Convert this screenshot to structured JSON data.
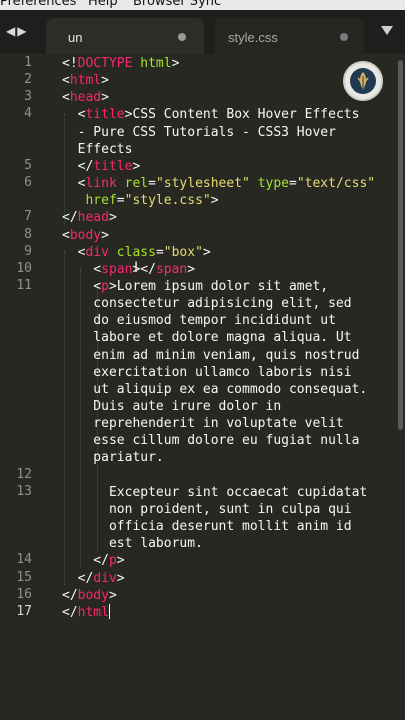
{
  "menubar": {
    "items": [
      "Preferences",
      "Help",
      "Browser Sync"
    ]
  },
  "tabs": [
    {
      "label": "un",
      "active": true
    },
    {
      "label": "style.css",
      "active": false
    }
  ],
  "icons": {
    "nav": "left-right-arrows",
    "dropdown": "triangle-down",
    "logo": "leaf-emblem"
  },
  "colors": {
    "background": "#272822",
    "tag": "#f92672",
    "attribute": "#a6e22e",
    "string": "#e6db74",
    "text": "#f8f8f2"
  },
  "editor": {
    "line_numbers": [
      "1",
      "2",
      "3",
      "4",
      "5",
      "6",
      "7",
      "8",
      "9",
      "10",
      "11",
      "12",
      "13",
      "14",
      "15",
      "16",
      "17"
    ],
    "current_line": "17",
    "code": [
      [
        [
          "p",
          "<!"
        ],
        [
          "t",
          "DOCTYPE"
        ],
        [
          "p",
          " "
        ],
        [
          "a",
          "html"
        ],
        [
          "p",
          ">"
        ]
      ],
      [
        [
          "p",
          "<"
        ],
        [
          "t",
          "html"
        ],
        [
          "p",
          ">"
        ]
      ],
      [
        [
          "p",
          "<"
        ],
        [
          "t",
          "head"
        ],
        [
          "p",
          ">"
        ]
      ],
      [
        [
          "p",
          "  <"
        ],
        [
          "t",
          "title"
        ],
        [
          "p",
          ">"
        ],
        [
          "x",
          "CSS Content Box Hover Effects"
        ]
      ],
      [
        [
          "x",
          "  - Pure CSS Tutorials - CSS3 Hover"
        ]
      ],
      [
        [
          "x",
          "  Effects"
        ]
      ],
      [
        [
          "p",
          "  </"
        ],
        [
          "t",
          "title"
        ],
        [
          "p",
          ">"
        ]
      ],
      [
        [
          "p",
          "  <"
        ],
        [
          "t",
          "link"
        ],
        [
          "p",
          " "
        ],
        [
          "a",
          "rel"
        ],
        [
          "p",
          "="
        ],
        [
          "s",
          "\"stylesheet\""
        ],
        [
          "p",
          " "
        ],
        [
          "a",
          "type"
        ],
        [
          "p",
          "="
        ],
        [
          "s",
          "\"text/css\""
        ]
      ],
      [
        [
          "p",
          "   "
        ],
        [
          "a",
          "href"
        ],
        [
          "p",
          "="
        ],
        [
          "s",
          "\"style.css\""
        ],
        [
          "p",
          ">"
        ]
      ],
      [
        [
          "p",
          "</"
        ],
        [
          "t",
          "head"
        ],
        [
          "p",
          ">"
        ]
      ],
      [
        [
          "p",
          "<"
        ],
        [
          "t",
          "body"
        ],
        [
          "p",
          ">"
        ]
      ],
      [
        [
          "p",
          "  <"
        ],
        [
          "t",
          "div"
        ],
        [
          "p",
          " "
        ],
        [
          "a",
          "class"
        ],
        [
          "p",
          "="
        ],
        [
          "s",
          "\"box\""
        ],
        [
          "p",
          ">"
        ]
      ],
      [
        [
          "p",
          "    <"
        ],
        [
          "t",
          "span"
        ],
        [
          "p",
          "></"
        ],
        [
          "t",
          "span"
        ],
        [
          "p",
          ">"
        ]
      ],
      [
        [
          "p",
          "    <"
        ],
        [
          "t",
          "p"
        ],
        [
          "p",
          ">"
        ],
        [
          "x",
          "Lorem ipsum dolor sit amet,"
        ]
      ],
      [
        [
          "x",
          "    consectetur adipisicing elit, sed"
        ]
      ],
      [
        [
          "x",
          "    do eiusmod tempor incididunt ut"
        ]
      ],
      [
        [
          "x",
          "    labore et dolore magna aliqua. Ut"
        ]
      ],
      [
        [
          "x",
          "    enim ad minim veniam, quis nostrud"
        ]
      ],
      [
        [
          "x",
          "    exercitation ullamco laboris nisi"
        ]
      ],
      [
        [
          "x",
          "    ut aliquip ex ea commodo consequat."
        ]
      ],
      [
        [
          "x",
          "    Duis aute irure dolor in"
        ]
      ],
      [
        [
          "x",
          "    reprehenderit in voluptate velit"
        ]
      ],
      [
        [
          "x",
          "    esse cillum dolore eu fugiat nulla"
        ]
      ],
      [
        [
          "x",
          "    pariatur."
        ]
      ],
      [
        [
          "x",
          ""
        ]
      ],
      [
        [
          "x",
          "      Excepteur sint occaecat cupidatat"
        ]
      ],
      [
        [
          "x",
          "      non proident, sunt in culpa qui"
        ]
      ],
      [
        [
          "x",
          "      officia deserunt mollit anim id"
        ]
      ],
      [
        [
          "x",
          "      est laborum."
        ]
      ],
      [
        [
          "p",
          "    </"
        ],
        [
          "t",
          "p"
        ],
        [
          "p",
          ">"
        ]
      ],
      [
        [
          "p",
          "  </"
        ],
        [
          "t",
          "div"
        ],
        [
          "p",
          ">"
        ]
      ],
      [
        [
          "p",
          "</"
        ],
        [
          "t",
          "body"
        ],
        [
          "p",
          ">"
        ]
      ],
      [
        [
          "p",
          "</"
        ],
        [
          "t",
          "html"
        ]
      ]
    ]
  }
}
